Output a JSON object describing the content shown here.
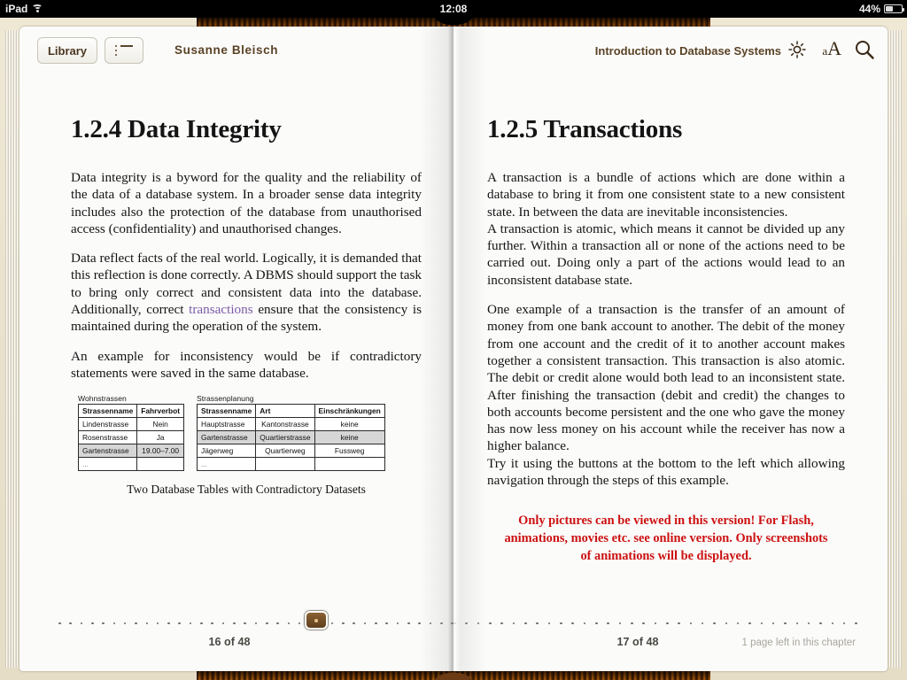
{
  "status_bar": {
    "device": "iPad",
    "wifi_icon": "wifi-icon",
    "time": "12:08",
    "battery_percent": "44%",
    "battery_icon": "battery-charging-icon"
  },
  "toolbar": {
    "library_label": "Library",
    "toc_icon": "table-of-contents-icon",
    "author": "Susanne Bleisch",
    "book_title": "Introduction to Database Systems",
    "brightness_icon": "brightness-sun-icon",
    "fontsize_small": "a",
    "fontsize_large": "A",
    "search_icon": "search-icon"
  },
  "left_page": {
    "heading": "1.2.4 Data Integrity",
    "paragraphs": [
      "Data integrity is a byword for the quality and the reliability of the data of a database system. In a broader sense data integrity includes also the protection of the database from unauthorised access (confidentiality) and unauthorised changes.",
      "An example for inconsistency would be if contradictory statements were saved in the same database."
    ],
    "paragraph2_part1": "Data reflect facts of the real world. Logically, it is demanded that this reflection is done correctly. A DBMS should support the task to bring only correct and consistent data into the database. Additionally, correct ",
    "paragraph2_link": "transactions",
    "paragraph2_part2": " ensure that the consistency is maintained during the operation of the system.",
    "figure": {
      "caption": "Two Database Tables with Contradictory Datasets",
      "tables": [
        {
          "title": "Wohnstrassen",
          "headers": [
            "Strassenname",
            "Fahrverbot"
          ],
          "rows": [
            {
              "cells": [
                "Lindenstrasse",
                "Nein"
              ],
              "highlight": false
            },
            {
              "cells": [
                "Rosenstrasse",
                "Ja"
              ],
              "highlight": false
            },
            {
              "cells": [
                "Gartenstrasse",
                "19.00–7.00"
              ],
              "highlight": true
            },
            {
              "cells": [
                "...",
                ""
              ],
              "highlight": false
            }
          ]
        },
        {
          "title": "Strassenplanung",
          "headers": [
            "Strassenname",
            "Art",
            "Einschränkungen"
          ],
          "rows": [
            {
              "cells": [
                "Hauptstrasse",
                "Kantonstrasse",
                "keine"
              ],
              "highlight": false
            },
            {
              "cells": [
                "Gartenstrasse",
                "Quartierstrasse",
                "keine"
              ],
              "highlight": true
            },
            {
              "cells": [
                "Jägerweg",
                "Quartierweg",
                "Fussweg"
              ],
              "highlight": false
            },
            {
              "cells": [
                "...",
                "",
                ""
              ],
              "highlight": false
            }
          ]
        }
      ]
    },
    "page_number": "16 of 48"
  },
  "right_page": {
    "heading": "1.2.5 Transactions",
    "paragraphs": [
      "A transaction is a bundle of actions which are done within a database to bring it from one consistent state to a new consistent state. In between the data are inevitable inconsistencies.",
      "A transaction is atomic, which means it cannot be divided up any further. Within a transaction all or none of the actions need to be carried out. Doing only a part of the actions would lead to an inconsistent database state.",
      "One example of a transaction is the transfer of an amount of money from one bank account to another. The debit of the money from one account and the credit of it to another account makes together a consistent transaction. This transaction is also atomic. The debit or credit alone would both lead to an inconsistent state. After finishing the transaction (debit and credit) the changes to both accounts become persistent and the one who gave the money has now less money on his account while the receiver has now a higher balance.",
      "Try it using the buttons at the bottom to the left which allowing navigation through the steps of this example."
    ],
    "notice": "Only pictures can be viewed in this version! For Flash, animations, movies etc. see online version. Only screenshots of animations will be displayed.",
    "page_number": "17 of 48",
    "chapter_remaining": "1 page left in this chapter"
  },
  "colors": {
    "link": "#7b5ba6",
    "notice": "#cc1111",
    "toolbar_text": "#5b4326",
    "slider_handle": "#6b4a22"
  }
}
